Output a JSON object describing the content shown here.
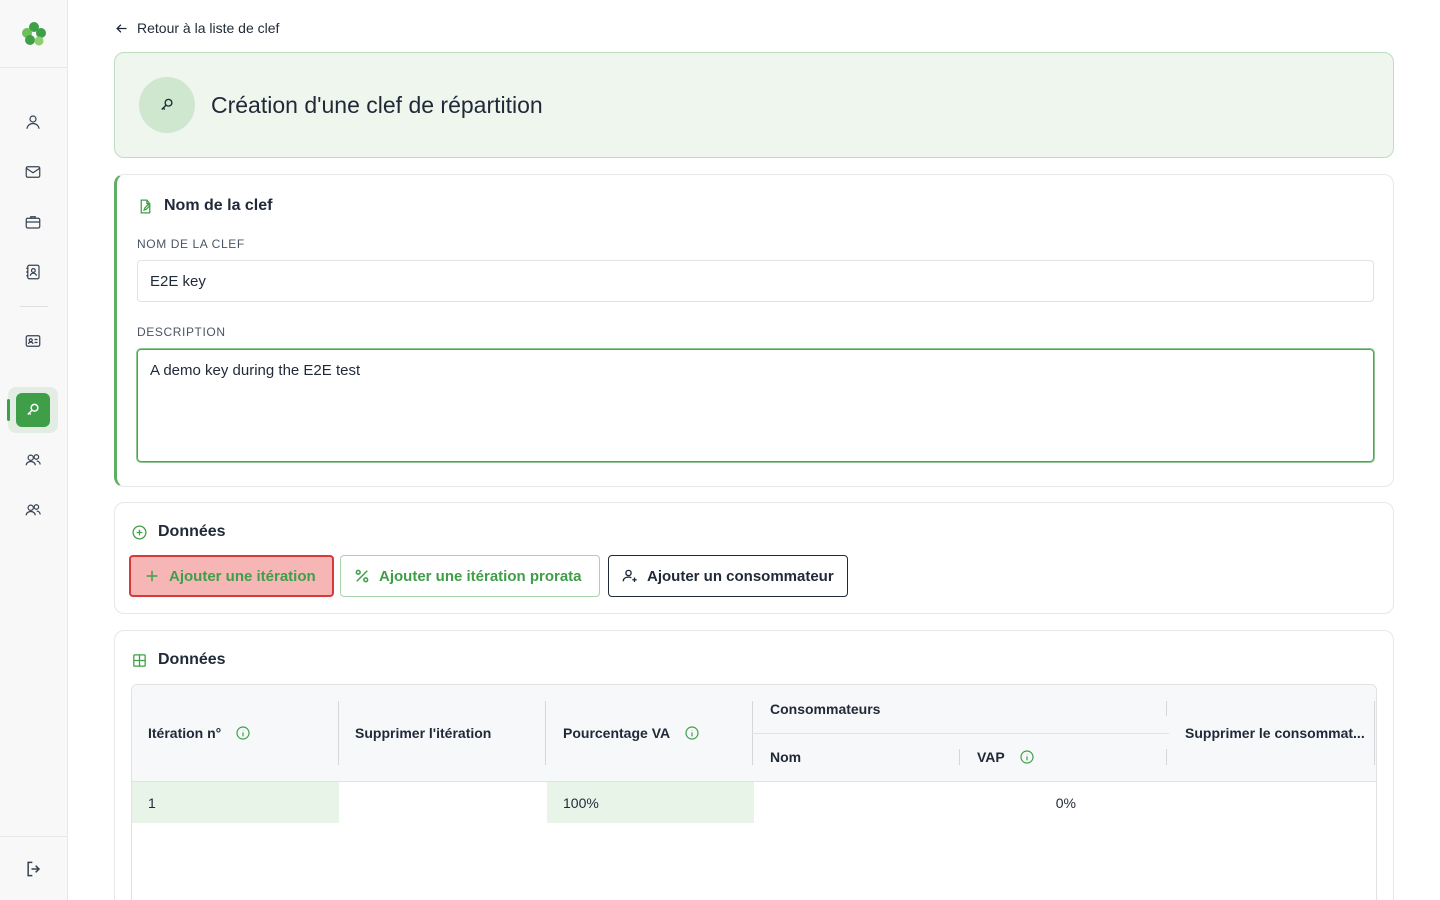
{
  "nav": {
    "back_label": "Retour à la liste de clef"
  },
  "header": {
    "title": "Création d'une clef de répartition"
  },
  "key_section": {
    "title": "Nom de la clef",
    "name_label": "NOM DE LA CLEF",
    "name_value": "E2E key",
    "description_label": "DESCRIPTION",
    "description_value": "A demo key during the E2E test"
  },
  "actions_section": {
    "title": "Données",
    "add_iteration": "Ajouter une itération",
    "add_iteration_prorata": "Ajouter une itération prorata",
    "add_consumer": "Ajouter un consommateur"
  },
  "table_section": {
    "title": "Données",
    "headers": {
      "iteration": "Itération n°",
      "delete_iteration": "Supprimer l'itération",
      "percentage": "Pourcentage VA",
      "consumers": "Consommateurs",
      "name": "Nom",
      "vap": "VAP",
      "delete_consumer": "Supprimer le consommat..."
    },
    "rows": [
      {
        "iteration": "1",
        "percentage": "100%",
        "vap": "0%"
      }
    ]
  },
  "colors": {
    "accent": "#3f9e48",
    "highlight_bg": "#f7b6b6",
    "highlight_border": "#d83a3a"
  }
}
